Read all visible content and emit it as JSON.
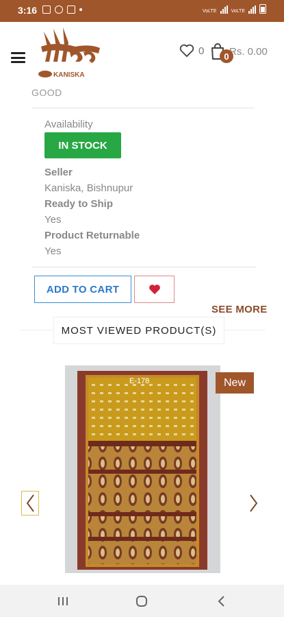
{
  "status_bar": {
    "time": "3:16",
    "net1": "VoLTE",
    "net2": "VoLTE"
  },
  "header": {
    "logo_text": "KANISKA",
    "wishlist_count": "0",
    "cart_count": "0",
    "cart_total": "Rs. 0.00"
  },
  "product": {
    "condition": "GOOD",
    "availability_label": "Availability",
    "stock_status": "IN STOCK",
    "seller_label": "Seller",
    "seller_value": "Kaniska, Bishnupur",
    "ready_label": "Ready to Ship",
    "ready_value": "Yes",
    "returnable_label": "Product Returnable",
    "returnable_value": "Yes",
    "add_to_cart": "ADD TO CART"
  },
  "most_viewed": {
    "see_more": "SEE MORE",
    "title": "MOST VIEWED PRODUCT(S)",
    "badge": "New",
    "product_code": "E-178"
  },
  "colors": {
    "brand": "#a0562b",
    "in_stock": "#27a844",
    "link_blue": "#2a79c9",
    "heart_red": "#d0233a"
  }
}
